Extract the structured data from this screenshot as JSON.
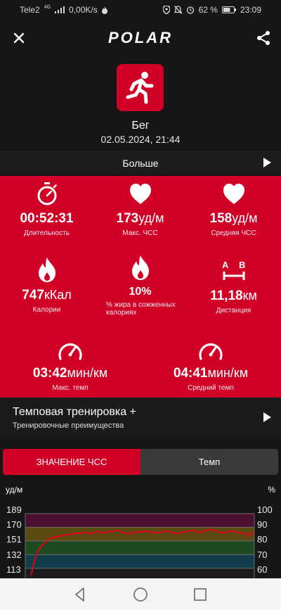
{
  "status_bar": {
    "carrier": "Tele2",
    "network": "4G",
    "data_rate": "0,00K/s",
    "battery": "62 %",
    "time": "23:09"
  },
  "app": {
    "logo": "POLAR"
  },
  "icons": {
    "close": "close-icon",
    "share": "share-icon",
    "sport": "running-person-icon"
  },
  "session": {
    "sport": "Бег",
    "datetime": "02.05.2024, 21:44"
  },
  "more": {
    "label": "Больше"
  },
  "stats": {
    "duration": {
      "value": "00:52:31",
      "unit": "",
      "label": "Длительность"
    },
    "max_hr": {
      "value": "173",
      "unit": "уд/м",
      "label": "Макс. ЧСС"
    },
    "avg_hr": {
      "value": "158",
      "unit": "уд/м",
      "label": "Средняя ЧСС"
    },
    "calories": {
      "value": "747",
      "unit": "кКал",
      "label": "Калории"
    },
    "fat_pct": {
      "value": "10%",
      "unit": "",
      "label": "% жира в сожженных калориях"
    },
    "distance": {
      "value": "11,18",
      "unit": "км",
      "label": "Дистанция"
    },
    "max_pace": {
      "value": "03:42",
      "unit": "мин/км",
      "label": "Макс. темп"
    },
    "avg_pace": {
      "value": "04:41",
      "unit": "мин/км",
      "label": "Средний темп"
    }
  },
  "training": {
    "title": "Темповая тренировка +",
    "subtitle": "Тренировочные преимущества"
  },
  "tabs": [
    {
      "label": "ЗНАЧЕНИЕ ЧСС",
      "active": true
    },
    {
      "label": "Темп",
      "active": false
    }
  ],
  "colors": {
    "accent": "#d10027",
    "background": "#161616",
    "zone5": "#4a1030",
    "zone4": "#5a4a10",
    "zone3": "#1e4a22",
    "zone2": "#123d4a",
    "hr_line": "#e3001b"
  },
  "chart_data": {
    "type": "line",
    "ylabel_left": "уд/м",
    "ylabel_right": "%",
    "left_ticks": [
      "189",
      "170",
      "151",
      "132",
      "113"
    ],
    "right_ticks": [
      "100",
      "90",
      "80",
      "70",
      "60"
    ],
    "ylim": [
      99,
      189
    ],
    "series": [
      {
        "values": [
          103,
          125,
          138,
          145,
          150,
          154,
          156,
          157,
          158,
          159,
          160,
          161,
          162,
          161,
          163,
          162,
          161,
          163,
          164,
          162,
          163,
          164,
          165,
          166,
          163,
          162,
          161,
          162,
          164,
          163,
          165,
          164,
          163,
          162,
          163,
          164,
          165,
          163,
          162,
          161,
          163,
          164,
          165,
          166,
          164,
          163,
          165,
          166,
          167,
          165,
          163,
          162,
          164,
          165,
          164,
          163,
          162,
          161,
          158,
          164
        ]
      }
    ]
  },
  "nav": {
    "back": "back-icon",
    "home": "home-icon",
    "recent": "recent-apps-icon"
  }
}
